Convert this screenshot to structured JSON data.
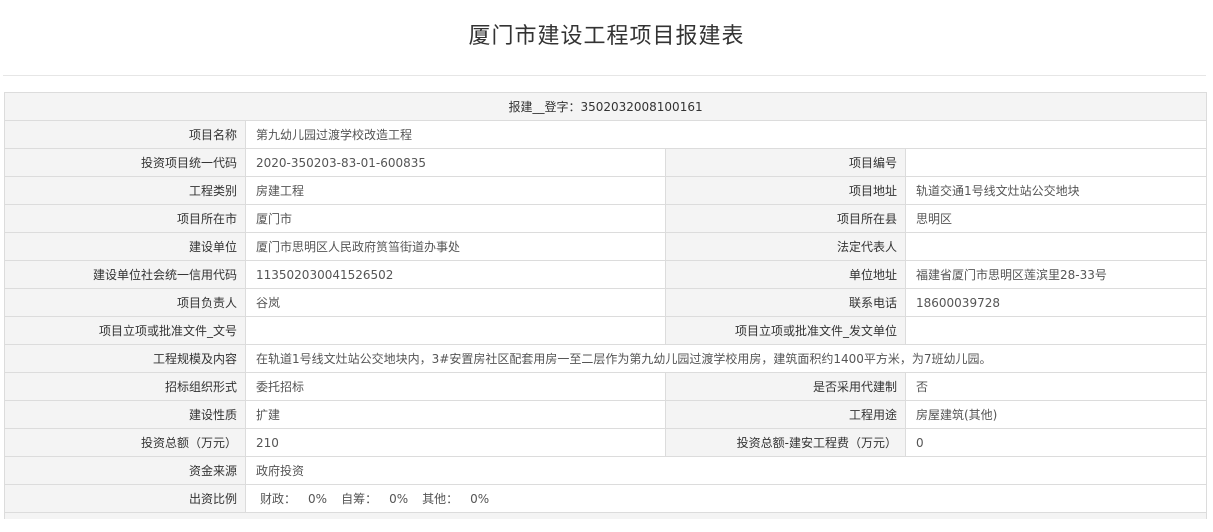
{
  "page": {
    "title": "厦门市建设工程项目报建表"
  },
  "header": {
    "registration": "报建__登字：3502032008100161"
  },
  "fields": {
    "project_name": {
      "label": "项目名称",
      "value": "第九幼儿园过渡学校改造工程"
    },
    "invest_code": {
      "label": "投资项目统一代码",
      "value": "2020-350203-83-01-600835"
    },
    "project_no": {
      "label": "项目编号",
      "value": ""
    },
    "category": {
      "label": "工程类别",
      "value": "房建工程"
    },
    "address": {
      "label": "项目地址",
      "value": "轨道交通1号线文灶站公交地块"
    },
    "city": {
      "label": "项目所在市",
      "value": "厦门市"
    },
    "county": {
      "label": "项目所在县",
      "value": "思明区"
    },
    "builder": {
      "label": "建设单位",
      "value": "厦门市思明区人民政府筼筜街道办事处"
    },
    "legal_rep": {
      "label": "法定代表人",
      "value": ""
    },
    "credit_code": {
      "label": "建设单位社会统一信用代码",
      "value": "113502030041526502"
    },
    "unit_address": {
      "label": "单位地址",
      "value": "福建省厦门市思明区莲滨里28-33号"
    },
    "manager": {
      "label": "项目负责人",
      "value": "谷岚"
    },
    "phone": {
      "label": "联系电话",
      "value": "18600039728"
    },
    "approval_doc_no": {
      "label": "项目立项或批准文件_文号",
      "value": ""
    },
    "approval_doc_unit": {
      "label": "项目立项或批准文件_发文单位",
      "value": ""
    },
    "scale_content": {
      "label": "工程规模及内容",
      "value": "在轨道1号线文灶站公交地块内，3#安置房社区配套用房一至二层作为第九幼儿园过渡学校用房，建筑面积约1400平方米，为7班幼儿园。"
    },
    "tender_form": {
      "label": "招标组织形式",
      "value": "委托招标"
    },
    "agent_build": {
      "label": "是否采用代建制",
      "value": "否"
    },
    "nature": {
      "label": "建设性质",
      "value": "扩建"
    },
    "usage": {
      "label": "工程用途",
      "value": "房屋建筑(其他)"
    },
    "total_invest": {
      "label": "投资总额（万元）",
      "value": "210"
    },
    "install_cost": {
      "label": "投资总额-建安工程费（万元）",
      "value": "0"
    },
    "fund_source": {
      "label": "资金来源",
      "value": "政府投资"
    },
    "funding_ratio": {
      "label": "出资比例",
      "finance_label": "财政：",
      "finance_value": "0%",
      "self_label": "自筹：",
      "self_value": "0%",
      "other_label": "其他：",
      "other_value": "0%"
    }
  }
}
